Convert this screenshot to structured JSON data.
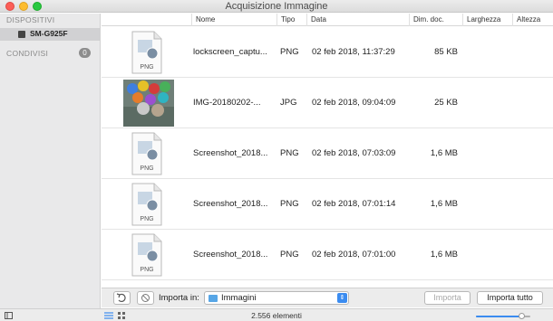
{
  "window": {
    "title": "Acquisizione Immagine"
  },
  "sidebar": {
    "devices_header": "DISPOSITIVI",
    "device_name": "SM-G925F",
    "shared_header": "CONDIVISI",
    "shared_count": "0"
  },
  "columns": [
    "Nome",
    "Tipo",
    "Data",
    "Dim. doc.",
    "Larghezza",
    "Altezza"
  ],
  "rows": [
    {
      "name": "lockscreen_captu...",
      "type": "PNG",
      "date": "02 feb 2018, 11:37:29",
      "size": "85 KB",
      "thumb": "png",
      "thumb_label": "PNG"
    },
    {
      "name": "IMG-20180202-...",
      "type": "JPG",
      "date": "02 feb 2018, 09:04:09",
      "size": "25 KB",
      "thumb": "photo",
      "thumb_label": ""
    },
    {
      "name": "Screenshot_2018...",
      "type": "PNG",
      "date": "02 feb 2018, 07:03:09",
      "size": "1,6 MB",
      "thumb": "png",
      "thumb_label": "PNG"
    },
    {
      "name": "Screenshot_2018...",
      "type": "PNG",
      "date": "02 feb 2018, 07:01:14",
      "size": "1,6 MB",
      "thumb": "png",
      "thumb_label": "PNG"
    },
    {
      "name": "Screenshot_2018...",
      "type": "PNG",
      "date": "02 feb 2018, 07:01:00",
      "size": "1,6 MB",
      "thumb": "png",
      "thumb_label": "PNG"
    }
  ],
  "toolbar": {
    "rotate_icon": "rotate-left-icon",
    "delete_icon": "no-entry-icon",
    "import_label": "Importa in:",
    "import_destination": "Immagini",
    "import_button": "Importa",
    "import_all_button": "Importa tutto"
  },
  "statusbar": {
    "count_text": "2.556 elementi",
    "zoom_fraction": 0.85
  },
  "colors": {
    "accent": "#3b8cf0"
  }
}
